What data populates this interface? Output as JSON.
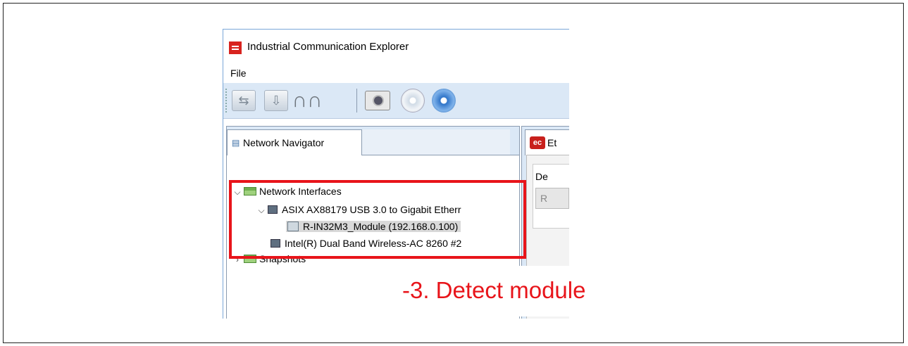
{
  "window": {
    "title": "Industrial Communication Explorer"
  },
  "menu": {
    "file": "File"
  },
  "toolbar": {
    "buttons": [
      "forward-arrow-icon",
      "download-arrow-icon",
      "binoculars-icon",
      "camera-icon",
      "disc-gray-icon",
      "disc-blue-icon"
    ]
  },
  "navigator": {
    "tab_label": "Network Navigator",
    "tree": {
      "network_interfaces": "Network Interfaces",
      "asix": "ASIX AX88179 USB 3.0 to Gigabit Etherr",
      "module": "R-IN32M3_Module (192.168.0.100)",
      "intel": "Intel(R) Dual Band Wireless-AC 8260 #2",
      "snapshots": "Snapshots"
    }
  },
  "right_panel": {
    "tab_label": "Et",
    "group_label": "De",
    "field_value": "R"
  },
  "annotation": {
    "text": "-3. Detect module",
    "color": "#e8141a"
  }
}
